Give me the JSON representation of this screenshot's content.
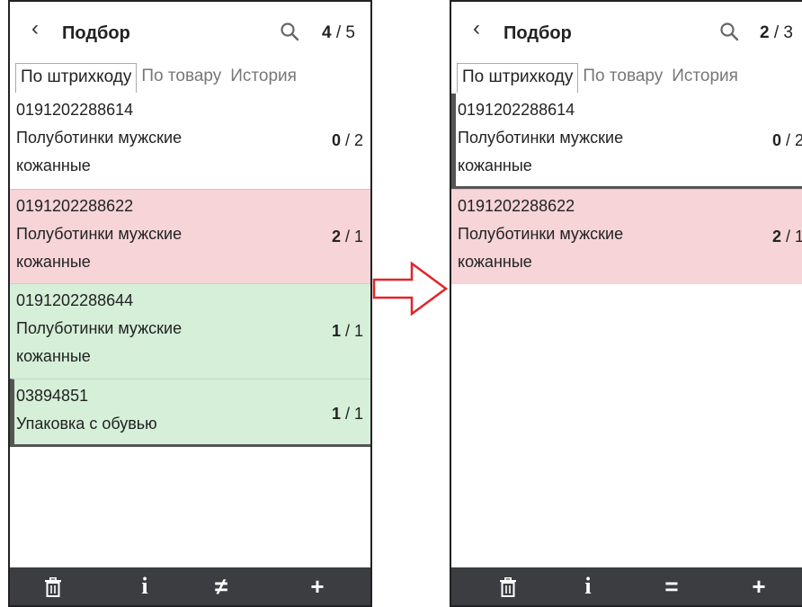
{
  "left": {
    "title": "Подбор",
    "counter_current": "4",
    "counter_sep": " / ",
    "counter_total": "5",
    "tabs": [
      "По штрихкоду",
      "По товару",
      "История"
    ],
    "items": [
      {
        "code": "0191202288614",
        "name": "Полуботинки мужские кожанные",
        "qty_done": "0",
        "qty_sep": " / ",
        "qty_total": "2",
        "state": "none"
      },
      {
        "code": "0191202288622",
        "name": "Полуботинки мужские кожанные",
        "qty_done": "2",
        "qty_sep": " / ",
        "qty_total": "1",
        "state": "over"
      },
      {
        "code": "0191202288644",
        "name": "Полуботинки мужские кожанные",
        "qty_done": "1",
        "qty_sep": " / ",
        "qty_total": "1",
        "state": "ok"
      },
      {
        "code": "03894851",
        "name": "Упаковка с обувью",
        "qty_done": "1",
        "qty_sep": " / ",
        "qty_total": "1",
        "state": "ok"
      }
    ],
    "toolbar": {
      "compare_symbol": "≠",
      "add_symbol": "+",
      "info_symbol": "i"
    }
  },
  "right": {
    "title": "Подбор",
    "counter_current": "2",
    "counter_sep": " / ",
    "counter_total": "3",
    "tabs": [
      "По штрихкоду",
      "По товару",
      "История"
    ],
    "items": [
      {
        "code": "0191202288614",
        "name": "Полуботинки мужские кожанные",
        "qty_done": "0",
        "qty_sep": " / ",
        "qty_total": "2",
        "state": "none"
      },
      {
        "code": "0191202288622",
        "name": "Полуботинки мужские кожанные",
        "qty_done": "2",
        "qty_sep": " / ",
        "qty_total": "1",
        "state": "over"
      }
    ],
    "toolbar": {
      "compare_symbol": "=",
      "add_symbol": "+",
      "info_symbol": "i"
    }
  },
  "colors": {
    "over": "#f6d4d8",
    "ok": "#d5efd8",
    "toolbar": "#3b3d40",
    "arrow": "#e0252b"
  }
}
